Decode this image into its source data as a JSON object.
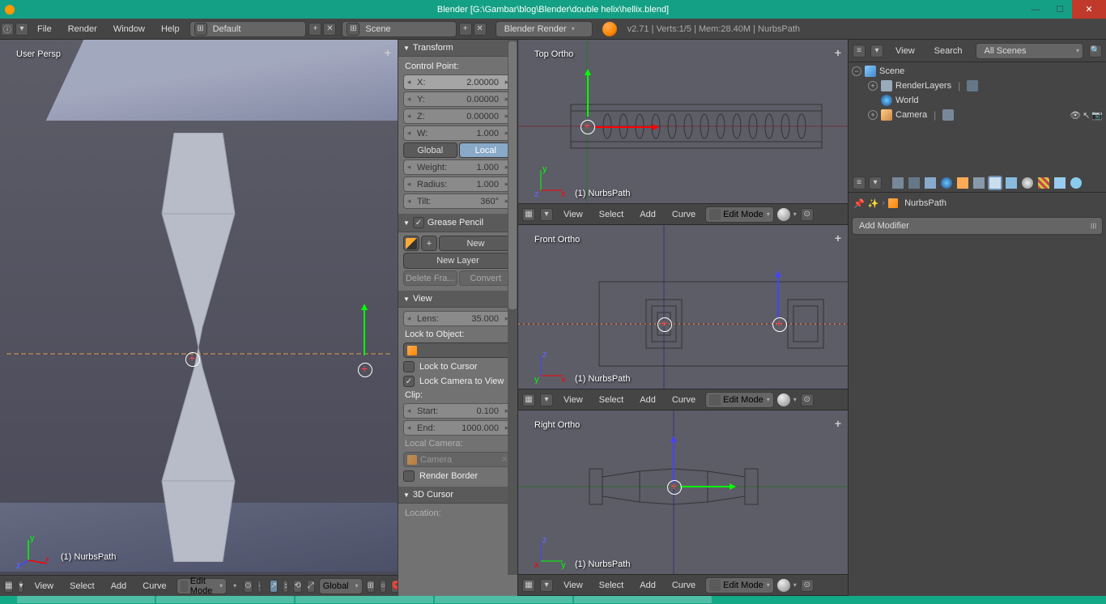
{
  "title": "Blender [G:\\Gambar\\blog\\Blender\\double helix\\hellix.blend]",
  "menubar": {
    "file": "File",
    "render": "Render",
    "window": "Window",
    "help": "Help",
    "layout_dropdown": "Default",
    "scene_dropdown": "Scene",
    "engine_dropdown": "Blender Render",
    "info": "v2.71 | Verts:1/5 | Mem:28.40M | NurbsPath"
  },
  "viewport_left": {
    "label": "User Persp",
    "obj_label": "(1) NurbsPath"
  },
  "header_menu": {
    "view": "View",
    "select": "Select",
    "add": "Add",
    "curve": "Curve",
    "mode": "Edit Mode",
    "orient": "Global"
  },
  "n_panel": {
    "transform_header": "Transform",
    "control_point": "Control Point:",
    "x_label": "X:",
    "x_value": "2.00000",
    "y_label": "Y:",
    "y_value": "0.00000",
    "z_label": "Z:",
    "z_value": "0.00000",
    "w_label": "W:",
    "w_value": "1.000",
    "global": "Global",
    "local": "Local",
    "weight_label": "Weight:",
    "weight_value": "1.000",
    "radius_label": "Radius:",
    "radius_value": "1.000",
    "tilt_label": "Tilt:",
    "tilt_value": "360°",
    "grease_header": "Grease Pencil",
    "new": "New",
    "new_layer": "New Layer",
    "delete_frame": "Delete Fra...",
    "convert": "Convert",
    "view_header": "View",
    "lens_label": "Lens:",
    "lens_value": "35.000",
    "lock_to_object": "Lock to Object:",
    "lock_to_cursor": "Lock to Cursor",
    "lock_camera": "Lock Camera to View",
    "clip": "Clip:",
    "start_label": "Start:",
    "start_value": "0.100",
    "end_label": "End:",
    "end_value": "1000.000",
    "local_camera": "Local Camera:",
    "camera_name": "Camera",
    "render_border": "Render Border",
    "cursor_header": "3D Cursor",
    "location": "Location:"
  },
  "viewports_right": {
    "top": {
      "label": "Top Ortho",
      "obj": "(1) NurbsPath"
    },
    "front": {
      "label": "Front Ortho",
      "obj": "(1) NurbsPath"
    },
    "right": {
      "label": "Right Ortho",
      "obj": "(1) NurbsPath"
    }
  },
  "outliner": {
    "view": "View",
    "search": "Search",
    "filter": "All Scenes",
    "scene": "Scene",
    "renderlayers": "RenderLayers",
    "world": "World",
    "camera": "Camera"
  },
  "properties": {
    "object_name": "NurbsPath",
    "add_modifier": "Add Modifier"
  }
}
